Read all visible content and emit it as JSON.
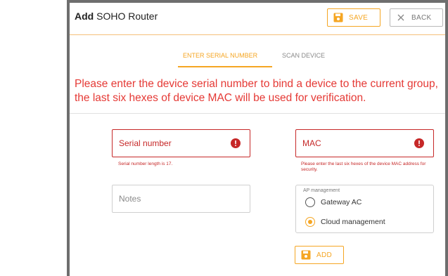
{
  "header": {
    "title_bold": "Add",
    "title_rest": "SOHO Router",
    "save_label": "SAVE",
    "back_label": "BACK"
  },
  "tabs": [
    {
      "label": "ENTER SERIAL NUMBER",
      "active": true
    },
    {
      "label": "SCAN DEVICE",
      "active": false
    }
  ],
  "message": "Please enter the device serial number to bind a device to the current group, the last six hexes of device MAC will be used for verification.",
  "form": {
    "serial": {
      "placeholder": "Serial number",
      "error": "Serial number length is 17."
    },
    "mac": {
      "placeholder": "MAC",
      "error": "Please enter the last six hexes of the device MAC address for security."
    },
    "notes": {
      "placeholder": "Notes"
    },
    "ap_management": {
      "title": "AP management",
      "options": [
        {
          "label": "Gateway AC",
          "selected": false
        },
        {
          "label": "Cloud management",
          "selected": true
        }
      ]
    },
    "add_label": "ADD"
  },
  "colors": {
    "accent": "#f5a623",
    "error": "#c62828",
    "message": "#e53935"
  },
  "icons": {
    "save": "floppy-disk-icon",
    "back": "close-x-icon",
    "error": "error-circle-icon",
    "add": "floppy-disk-icon"
  }
}
